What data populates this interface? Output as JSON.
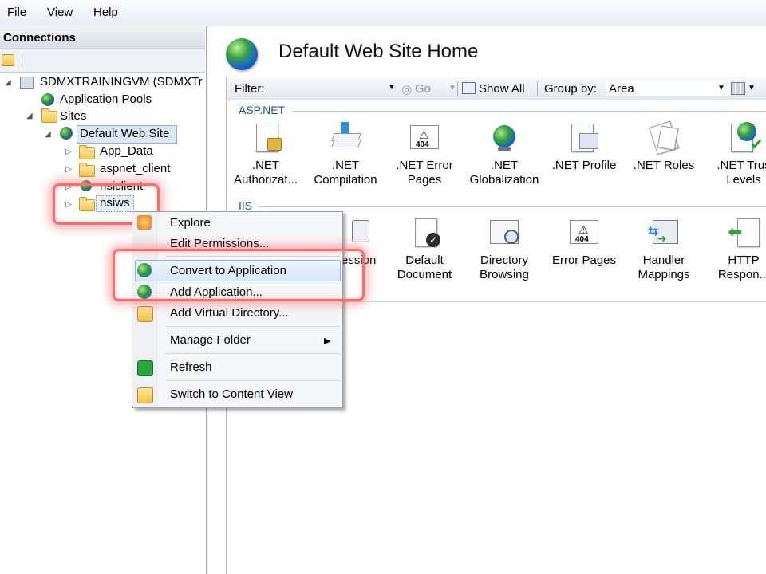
{
  "menu": {
    "items": [
      "File",
      "View",
      "Help"
    ]
  },
  "connections": {
    "title": "Connections",
    "tree": {
      "server": "SDMXTRAININGVM (SDMXTr",
      "app_pools": "Application Pools",
      "sites": "Sites",
      "default_site": "Default Web Site",
      "children": [
        "App_Data",
        "aspnet_client",
        "nsiclient",
        "nsiws"
      ]
    }
  },
  "main": {
    "title": "Default Web Site Home",
    "filter": {
      "label": "Filter:",
      "go": "Go",
      "show_all": "Show All",
      "group_by_label": "Group by:",
      "group_by_value": "Area"
    },
    "sections": [
      {
        "label": "ASP.NET",
        "features": [
          {
            "line1": ".NET",
            "line2": "Authorizat...",
            "icon": "lock-page-icon"
          },
          {
            "line1": ".NET",
            "line2": "Compilation",
            "icon": "download-stack-icon"
          },
          {
            "line1": ".NET Error",
            "line2": "Pages",
            "icon": "warning-404-icon"
          },
          {
            "line1": ".NET",
            "line2": "Globalization",
            "icon": "globe-icon"
          },
          {
            "line1": ".NET Profile",
            "line2": "",
            "icon": "profile-icon"
          },
          {
            "line1": ".NET Roles",
            "line2": "",
            "icon": "roles-icon"
          },
          {
            "line1": ".NET Trus",
            "line2": "Levels",
            "icon": "globe-check-icon"
          }
        ]
      },
      {
        "label": "IIS",
        "features": [
          {
            "line1": "ression",
            "line2": "",
            "icon": "compression-icon"
          },
          {
            "line1": "Default",
            "line2": "Document",
            "icon": "document-check-icon"
          },
          {
            "line1": "Directory",
            "line2": "Browsing",
            "icon": "directory-browse-icon"
          },
          {
            "line1": "Error Pages",
            "line2": "",
            "icon": "warning-404-icon"
          },
          {
            "line1": "Handler",
            "line2": "Mappings",
            "icon": "handler-arrows-icon"
          },
          {
            "line1": "HTTP",
            "line2": "Respon...",
            "icon": "http-response-icon"
          }
        ]
      }
    ]
  },
  "context_menu": {
    "items": [
      "Explore",
      "Edit Permissions...",
      "Convert to Application",
      "Add Application...",
      "Add Virtual Directory...",
      "Manage Folder",
      "Refresh",
      "Switch to Content View"
    ],
    "highlighted": "Convert to Application",
    "submenu_arrow": "▶"
  },
  "colors": {
    "highlight_red": "#ff6a6a",
    "selection_blue": "#dbe8f8",
    "section_blue": "#1f4e96"
  }
}
